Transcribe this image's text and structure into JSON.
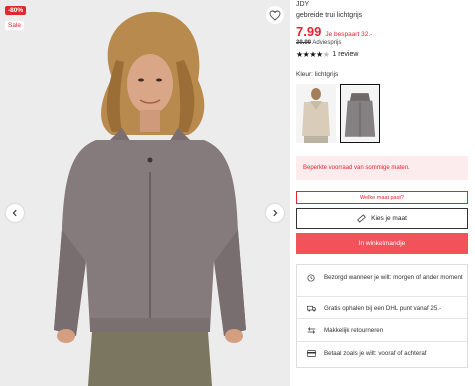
{
  "badges": {
    "discount": "-80%",
    "sale": "Sale"
  },
  "product": {
    "brand": "JDY",
    "name": "gebreide trui lichtgrijs",
    "price": "7.99",
    "saving": "Je bespaart 32.-",
    "old_price": "39.99",
    "advice_label": "Adviesprijs",
    "rating": {
      "stars": 4,
      "max": 5,
      "reviews": "1 review"
    },
    "color_label": "Kleur: lichtgrijs"
  },
  "gallery": {
    "prev_icon": "chevron-left-icon",
    "next_icon": "chevron-right-icon",
    "wishlist_icon": "heart-icon"
  },
  "stock_note": "Beperkte voorraad van sommige maten.",
  "size_help": "Welke maat past?",
  "size_select": "Kies je maat",
  "cart_button": "In winkelmandje",
  "usps": [
    {
      "icon": "clock-icon",
      "text": "Bezorgd wanneer je wilt: morgen of ander moment"
    },
    {
      "icon": "truck-icon",
      "text": "Gratis ophalen bij een DHL punt vanaf 25.-"
    },
    {
      "icon": "return-icon",
      "text": "Makkelijk retourneren"
    },
    {
      "icon": "payment-icon",
      "text": "Betaal zoals je wilt: vooraf of achteraf"
    }
  ],
  "colors": {
    "accent": "#e3262f",
    "button": "#f2525a",
    "note_bg": "#fdeced"
  }
}
